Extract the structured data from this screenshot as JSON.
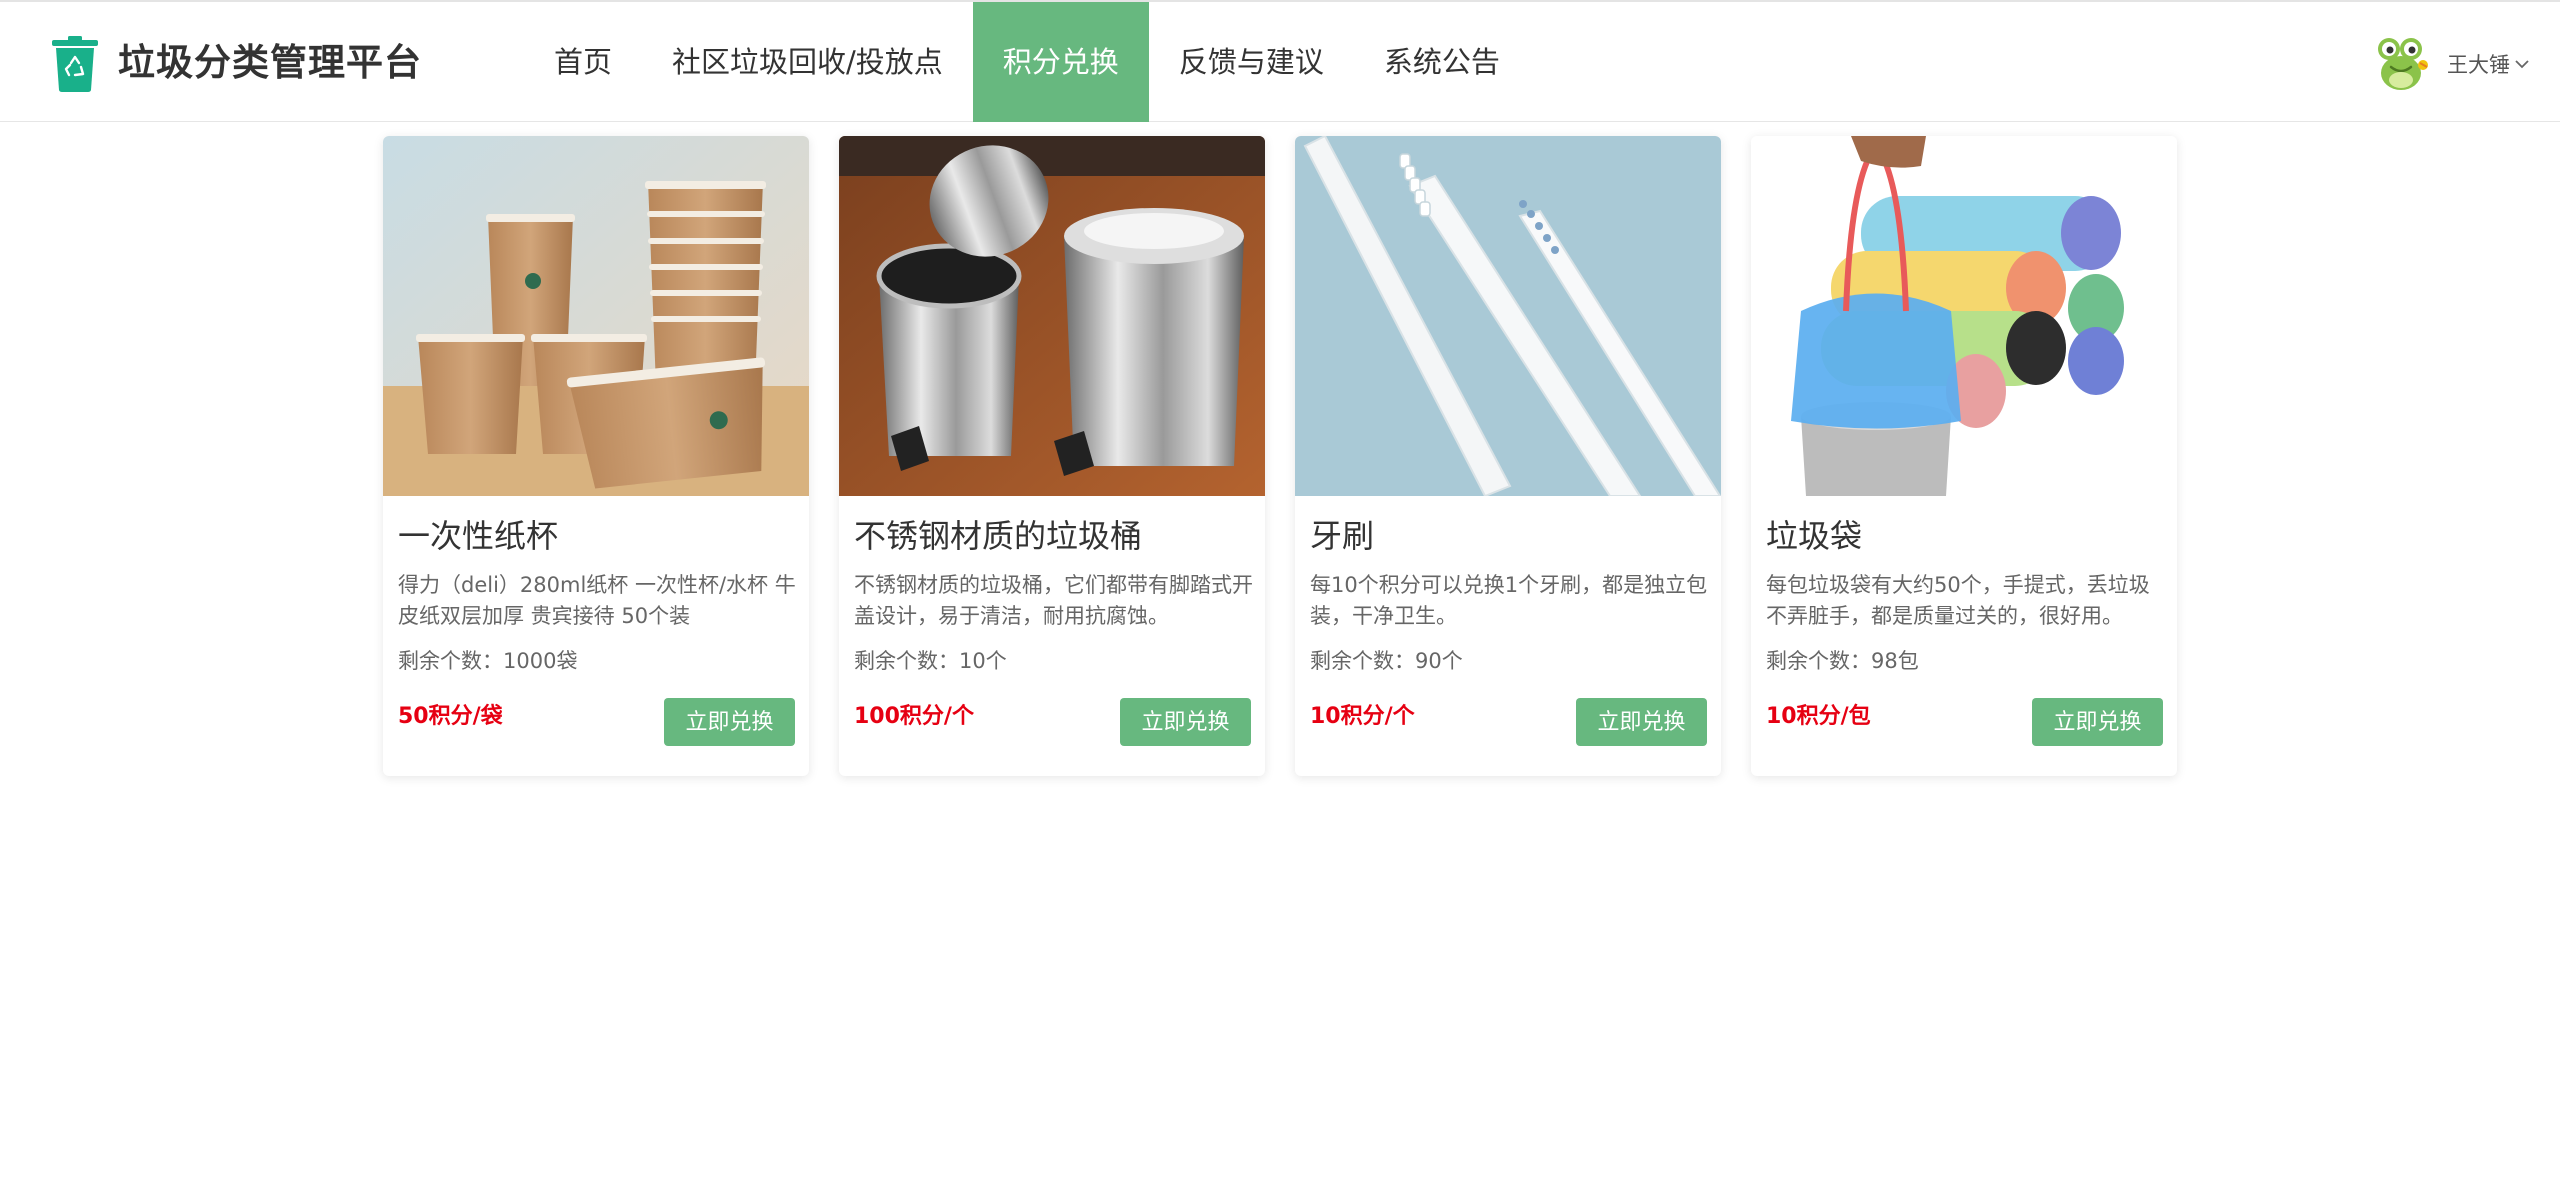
{
  "header": {
    "brand": "垃圾分类管理平台",
    "logo_icon": "trash-bin-recycle-icon",
    "accent_color": "#67b87f",
    "nav": [
      {
        "label": "首页",
        "active": false
      },
      {
        "label": "社区垃圾回收/投放点",
        "active": false
      },
      {
        "label": "积分兑换",
        "active": true
      },
      {
        "label": "反馈与建议",
        "active": false
      },
      {
        "label": "系统公告",
        "active": false
      }
    ],
    "user": {
      "name": "王大锤",
      "avatar_icon": "frog-avatar-icon",
      "dropdown_icon": "chevron-down-icon"
    }
  },
  "products": [
    {
      "title": "一次性纸杯",
      "description": "得力（deli）280ml纸杯 一次性杯/水杯 牛皮纸双层加厚 贵宾接待 50个装",
      "stock": "剩余个数：1000袋",
      "price": "50积分/袋",
      "button": "立即兑换",
      "image": "paper-cups-image"
    },
    {
      "title": "不锈钢材质的垃圾桶",
      "description": "不锈钢材质的垃圾桶，它们都带有脚踏式开盖设计，易于清洁，耐用抗腐蚀。",
      "stock": "剩余个数：10个",
      "price": "100积分/个",
      "button": "立即兑换",
      "image": "steel-trash-can-image"
    },
    {
      "title": "牙刷",
      "description": "每10个积分可以兑换1个牙刷，都是独立包装，干净卫生。",
      "stock": "剩余个数：90个",
      "price": "10积分/个",
      "button": "立即兑换",
      "image": "toothbrush-image"
    },
    {
      "title": "垃圾袋",
      "description": "每包垃圾袋有大约50个，手提式，丢垃圾不弄脏手，都是质量过关的，很好用。",
      "stock": "剩余个数：98包",
      "price": "10积分/包",
      "button": "立即兑换",
      "image": "garbage-bags-image"
    }
  ]
}
